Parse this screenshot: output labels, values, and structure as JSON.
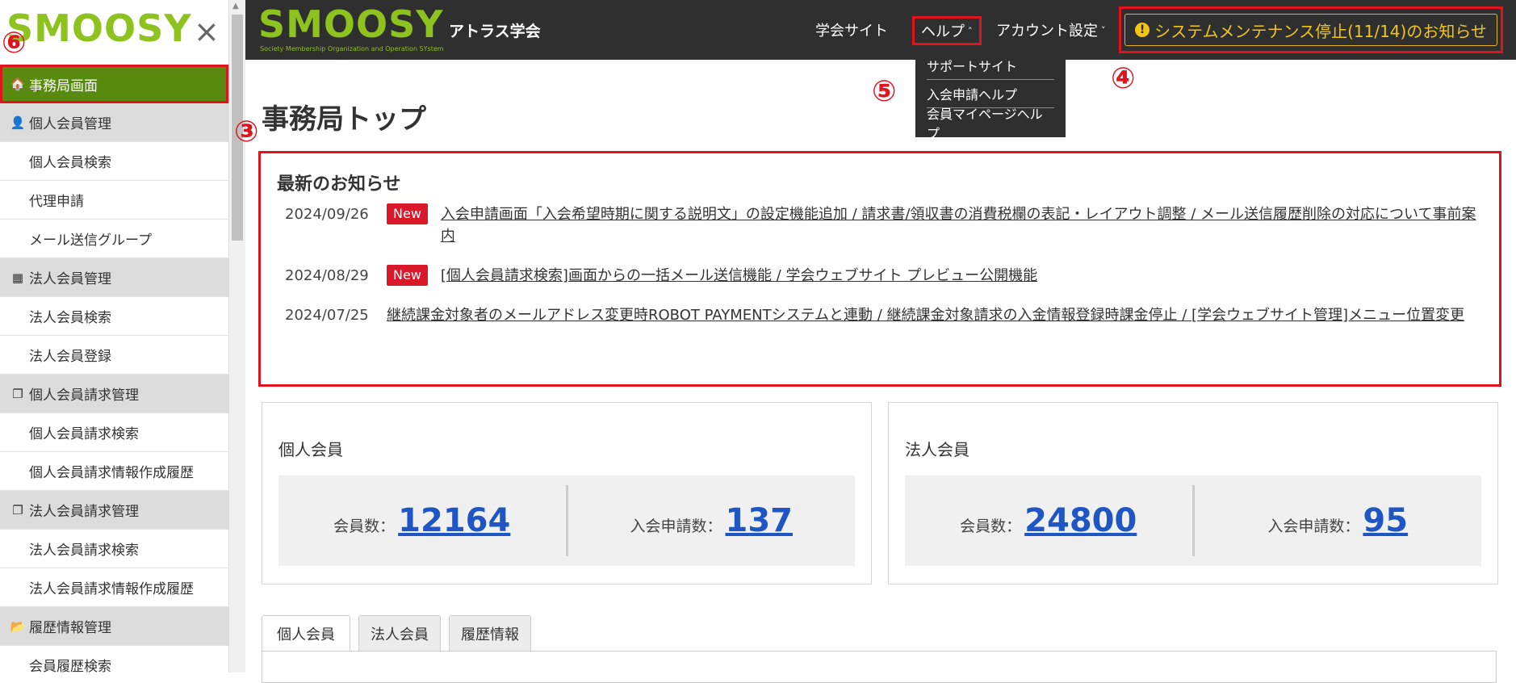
{
  "sidebar": {
    "logo": "SMOOSY",
    "close_icon": "×",
    "items": [
      {
        "label": "事務局画面",
        "type": "active",
        "icon": "🏠"
      },
      {
        "label": "個人会員管理",
        "type": "group",
        "icon": "👤"
      },
      {
        "label": "個人会員検索",
        "type": "sub"
      },
      {
        "label": "代理申請",
        "type": "sub"
      },
      {
        "label": "メール送信グループ",
        "type": "sub"
      },
      {
        "label": "法人会員管理",
        "type": "group",
        "icon": "▦"
      },
      {
        "label": "法人会員検索",
        "type": "sub"
      },
      {
        "label": "法人会員登録",
        "type": "sub"
      },
      {
        "label": "個人会員請求管理",
        "type": "group",
        "icon": "❐"
      },
      {
        "label": "個人会員請求検索",
        "type": "sub"
      },
      {
        "label": "個人会員請求情報作成履歴",
        "type": "sub"
      },
      {
        "label": "法人会員請求管理",
        "type": "group",
        "icon": "❐"
      },
      {
        "label": "法人会員請求検索",
        "type": "sub"
      },
      {
        "label": "法人会員請求情報作成履歴",
        "type": "sub"
      },
      {
        "label": "履歴情報管理",
        "type": "group",
        "icon": "📂"
      },
      {
        "label": "会員履歴検索",
        "type": "sub"
      }
    ]
  },
  "header": {
    "logo": "SMOOSY",
    "logo_sub": "Society Membership Organization and Operation SYstem",
    "org_name": "アトラス学会",
    "nav_site": "学会サイト",
    "nav_help": "ヘルプ",
    "nav_account": "アカウント設定",
    "maintenance_notice": "システムメンテナンス停止(11/14)のお知らせ",
    "help_menu": [
      "サポートサイト",
      "入会申請ヘルプ",
      "会員マイページヘルプ"
    ]
  },
  "markers": {
    "m3": "③",
    "m4": "④",
    "m5": "⑤",
    "m6": "⑥"
  },
  "page_title": "事務局トップ",
  "news": {
    "title": "最新のお知らせ",
    "badge": "New",
    "items": [
      {
        "date": "2024/09/26",
        "new": true,
        "text": "入会申請画面「入会希望時期に関する説明文」の設定機能追加 / 請求書/領収書の消費税欄の表記・レイアウト調整 / メール送信履歴削除の対応について事前案内"
      },
      {
        "date": "2024/08/29",
        "new": true,
        "text": "[個人会員請求検索]画面からの一括メール送信機能 / 学会ウェブサイト プレビュー公開機能"
      },
      {
        "date": "2024/07/25",
        "new": false,
        "text": "継続課金対象者のメールアドレス変更時ROBOT PAYMENTシステムと連動 / 継続課金対象請求の入金情報登録時課金停止 / [学会ウェブサイト管理]メニュー位置変更"
      }
    ]
  },
  "cards": {
    "individual": {
      "title": "個人会員",
      "members_label": "会員数：",
      "members": "12164",
      "apps_label": "入会申請数：",
      "apps": "137"
    },
    "corporate": {
      "title": "法人会員",
      "members_label": "会員数：",
      "members": "24800",
      "apps_label": "入会申請数：",
      "apps": "95"
    }
  },
  "tabs": [
    "個人会員",
    "法人会員",
    "履歴情報"
  ]
}
